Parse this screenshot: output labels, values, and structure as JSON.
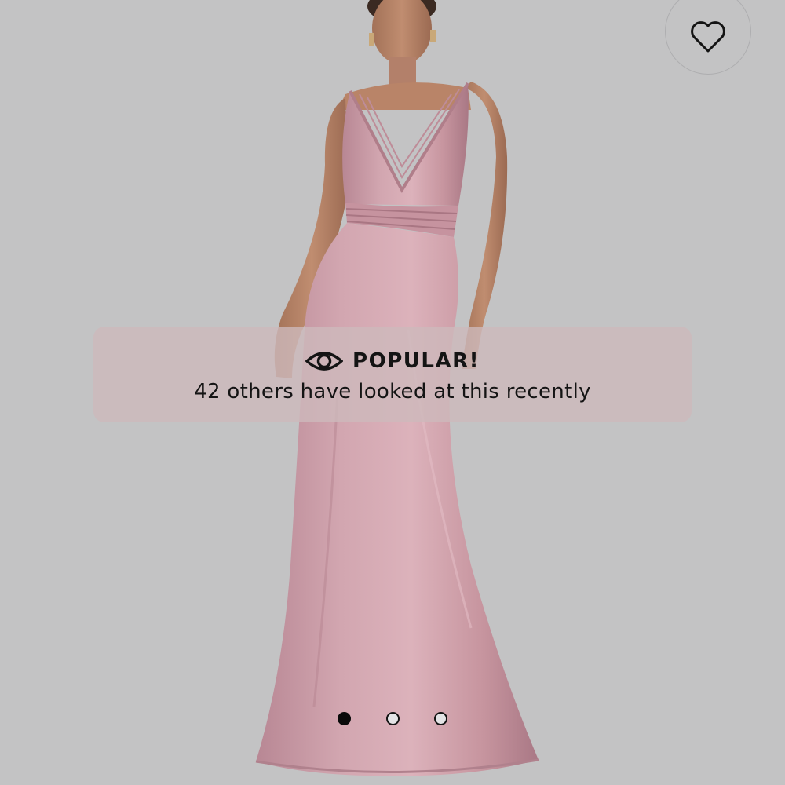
{
  "banner": {
    "icon": "eye-icon",
    "title": "POPULAR!",
    "subtitle": "42 others have looked at this recently"
  },
  "favorite": {
    "icon": "heart-outline-icon"
  },
  "carousel": {
    "total_slides": 3,
    "active_index": 0
  },
  "colors": {
    "background": "#c3c3c4",
    "dress": "#c99aa5",
    "banner": "#cdb9bc",
    "text": "#141414"
  }
}
